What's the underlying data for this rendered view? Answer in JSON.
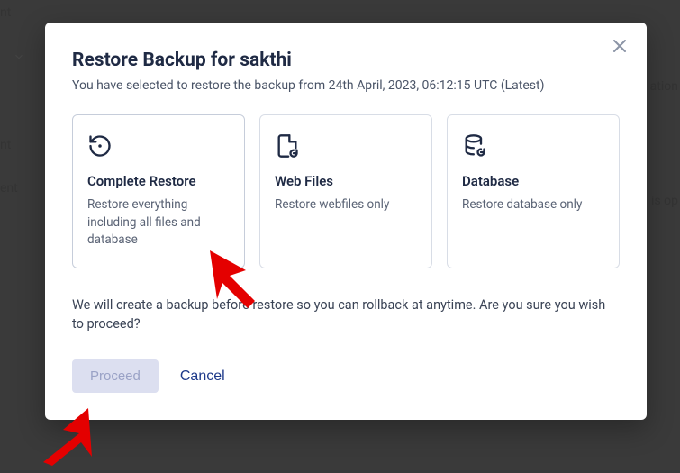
{
  "bg": {
    "t1": "nt",
    "t2": "nt",
    "t3": "ent",
    "t4": "ation",
    "t5": "is op"
  },
  "modal": {
    "title": "Restore Backup for sakthi",
    "subtitle": "You have selected to restore the backup from 24th April, 2023, 06:12:15 UTC (Latest)",
    "options": [
      {
        "title": "Complete Restore",
        "desc": "Restore everything including all files and database"
      },
      {
        "title": "Web Files",
        "desc": "Restore webfiles only"
      },
      {
        "title": "Database",
        "desc": "Restore database only"
      }
    ],
    "confirm": "We will create a backup before restore so you can rollback at anytime. Are you sure you wish to proceed?",
    "proceed": "Proceed",
    "cancel": "Cancel"
  }
}
